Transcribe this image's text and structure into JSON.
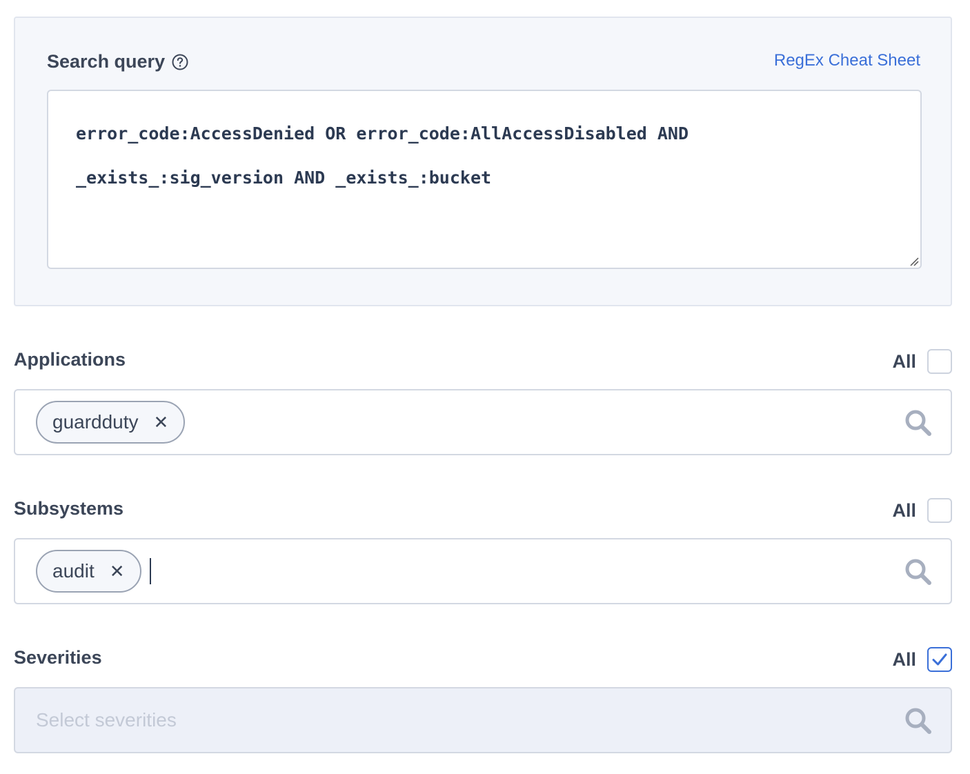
{
  "query": {
    "label": "Search query",
    "help_icon": "question-circle-icon",
    "regex_link": "RegEx Cheat Sheet",
    "value": "error_code:AccessDenied OR error_code:AllAccessDisabled AND _exists_:sig_version AND _exists_:bucket"
  },
  "applications": {
    "label": "Applications",
    "all_label": "All",
    "all_checked": false,
    "chips": [
      "guardduty"
    ]
  },
  "subsystems": {
    "label": "Subsystems",
    "all_label": "All",
    "all_checked": false,
    "chips": [
      "audit"
    ]
  },
  "severities": {
    "label": "Severities",
    "all_label": "All",
    "all_checked": true,
    "placeholder": "Select severities"
  },
  "colors": {
    "accent": "#3a6fd8",
    "text": "#3c4658",
    "panel_bg": "#f5f7fb",
    "disabled_bg": "#edf0f8"
  }
}
